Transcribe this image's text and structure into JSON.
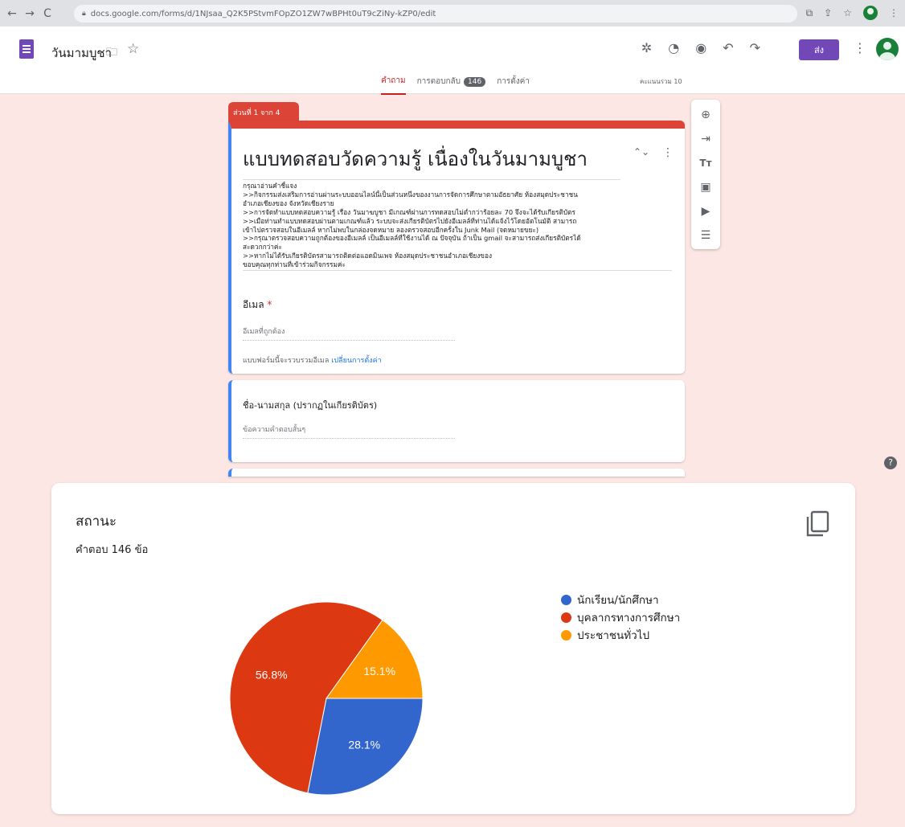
{
  "browser": {
    "url": "docs.google.com/forms/d/1NJsaa_Q2K5PStvmFOpZO1ZW7wBPHt0uT9cZiNy-kZP0/edit"
  },
  "header": {
    "doc_title": "วันมามบูชา",
    "send_label": "ส่ง",
    "tabs": [
      {
        "label": "คำถาม"
      },
      {
        "label": "การตอบกลับ",
        "badge": "146"
      },
      {
        "label": "การตั้งค่า"
      }
    ],
    "total_points": "คะแนนรวม 10"
  },
  "section": {
    "label": "ส่วนที่ 1 จาก 4"
  },
  "form": {
    "title": "แบบทดสอบวัดความรู้ เนื่องในวันมามบูชา",
    "description_lines": [
      "กรุณาอ่านคำชี้แจง",
      "     >>กิจกรรมส่งเสริมการอ่านผ่านระบบออนไลน์นี้เป็นส่วนหนึ่งของงานการจัดการศึกษาตามอัธยาศัย ห้องสมุดประชาชน",
      "อำเภอเชียงของ จังหวัดเชียงราย",
      "     >>การจัดทำแบบทดสอบความรู้ เรื่อง วันมาฆบูชา มีเกณฑ์ผ่านการทดสอบไม่ต่ำกว่าร้อยละ 70 จึงจะได้รับเกียรติบัตร",
      "     >>เมื่อท่านทำแบบทดสอบผ่านตามเกณฑ์แล้ว ระบบจะส่งเกียรติบัตรไปยังอีเมลล์ที่ท่านได้แจ้งไว้โดยอัตโนมัติ สามารถ",
      "เข้าไปตรวจสอบในอีเมลล์ หากไม่พบในกล่องจดหมาย ลองตรวจสอบอีกครั้งใน Junk Mail (จดหมายขยะ)",
      "     >>กรุณาตรวจสอบความถูกต้องของอีเมลล์ เป็นอีเมลล์ที่ใช้งานได้ ณ ปัจจุบัน ถ้าเป็น gmail จะสามารถส่งเกียรติบัตรได้",
      "สะดวกกว่าค่ะ",
      "     >>หากไม่ได้รับเกียรติบัตรสามารถติดต่อแอดมินเพจ ห้องสมุดประชาชนอำเภอเชียงของ",
      "     ขอบคุณทุกท่านที่เข้าร่วมกิจกรรมค่ะ"
    ],
    "email_label": "อีเมล",
    "email_required_mark": "*",
    "email_placeholder": "อีเมลที่ถูกต้อง",
    "collect_note": "แบบฟอร์มนี้จะรวบรวมอีเมล",
    "collect_link": "เปลี่ยนการตั้งค่า",
    "q2_label": "ชื่อ-นามสกุล (ปรากฏในเกียรติบัตร)",
    "q2_placeholder": "ข้อความคำตอบสั้นๆ"
  },
  "summary": {
    "title": "สถานะ",
    "count_text": "คำตอบ 146 ข้อ"
  },
  "chart_data": {
    "type": "pie",
    "categories": [
      "นักเรียน/นักศึกษา",
      "บุคลากรทางการศึกษา",
      "ประชาชนทั่วไป"
    ],
    "values": [
      28.1,
      56.8,
      15.1
    ],
    "labels": [
      "28.1%",
      "56.8%",
      "15.1%"
    ],
    "colors": [
      "#3366cc",
      "#dc3912",
      "#ff9900"
    ],
    "legend_position": "right"
  }
}
